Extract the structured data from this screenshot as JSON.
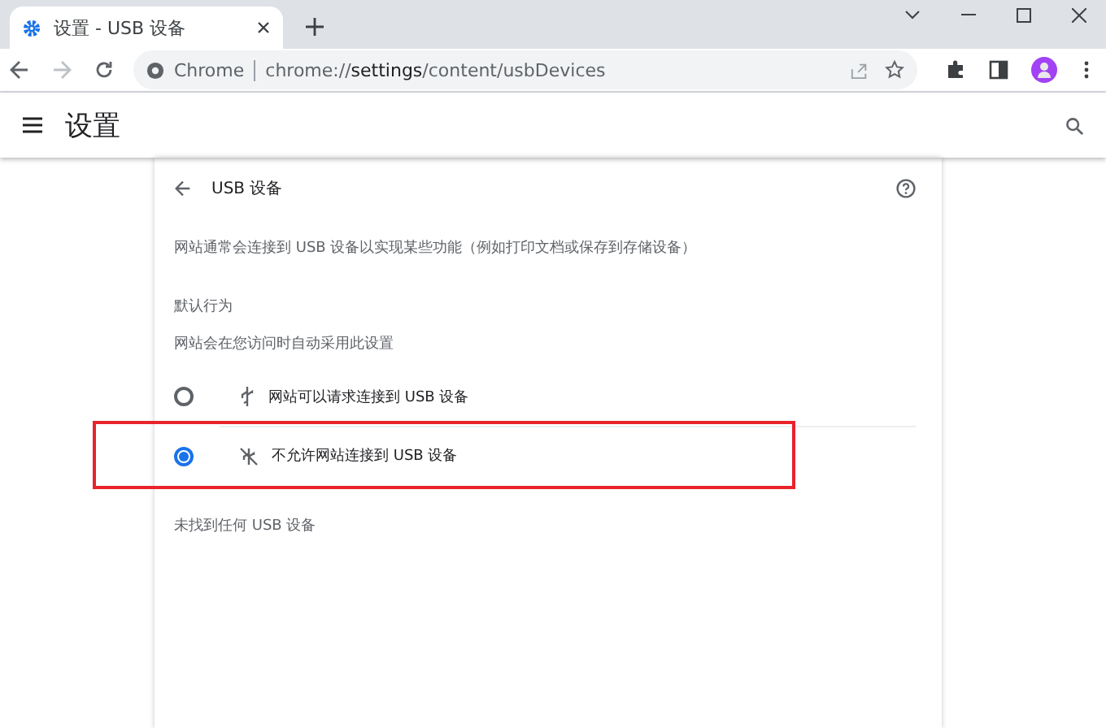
{
  "tab": {
    "title": "设置 - USB 设备"
  },
  "address": {
    "chip": "Chrome",
    "url_prefix": "chrome://",
    "url_host": "settings",
    "url_path": "/content/usbDevices"
  },
  "header": {
    "title": "设置"
  },
  "page": {
    "title": "USB 设备",
    "description": "网站通常会连接到 USB 设备以实现某些功能（例如打印文档或保存到存储设备）",
    "section_heading": "默认行为",
    "section_note": "网站会在您访问时自动采用此设置",
    "options": [
      {
        "kind": "allow",
        "label": "网站可以请求连接到 USB 设备",
        "selected": false,
        "highlighted": false
      },
      {
        "kind": "block",
        "label": "不允许网站连接到 USB 设备",
        "selected": true,
        "highlighted": true
      }
    ],
    "empty_message": "未找到任何 USB 设备"
  }
}
